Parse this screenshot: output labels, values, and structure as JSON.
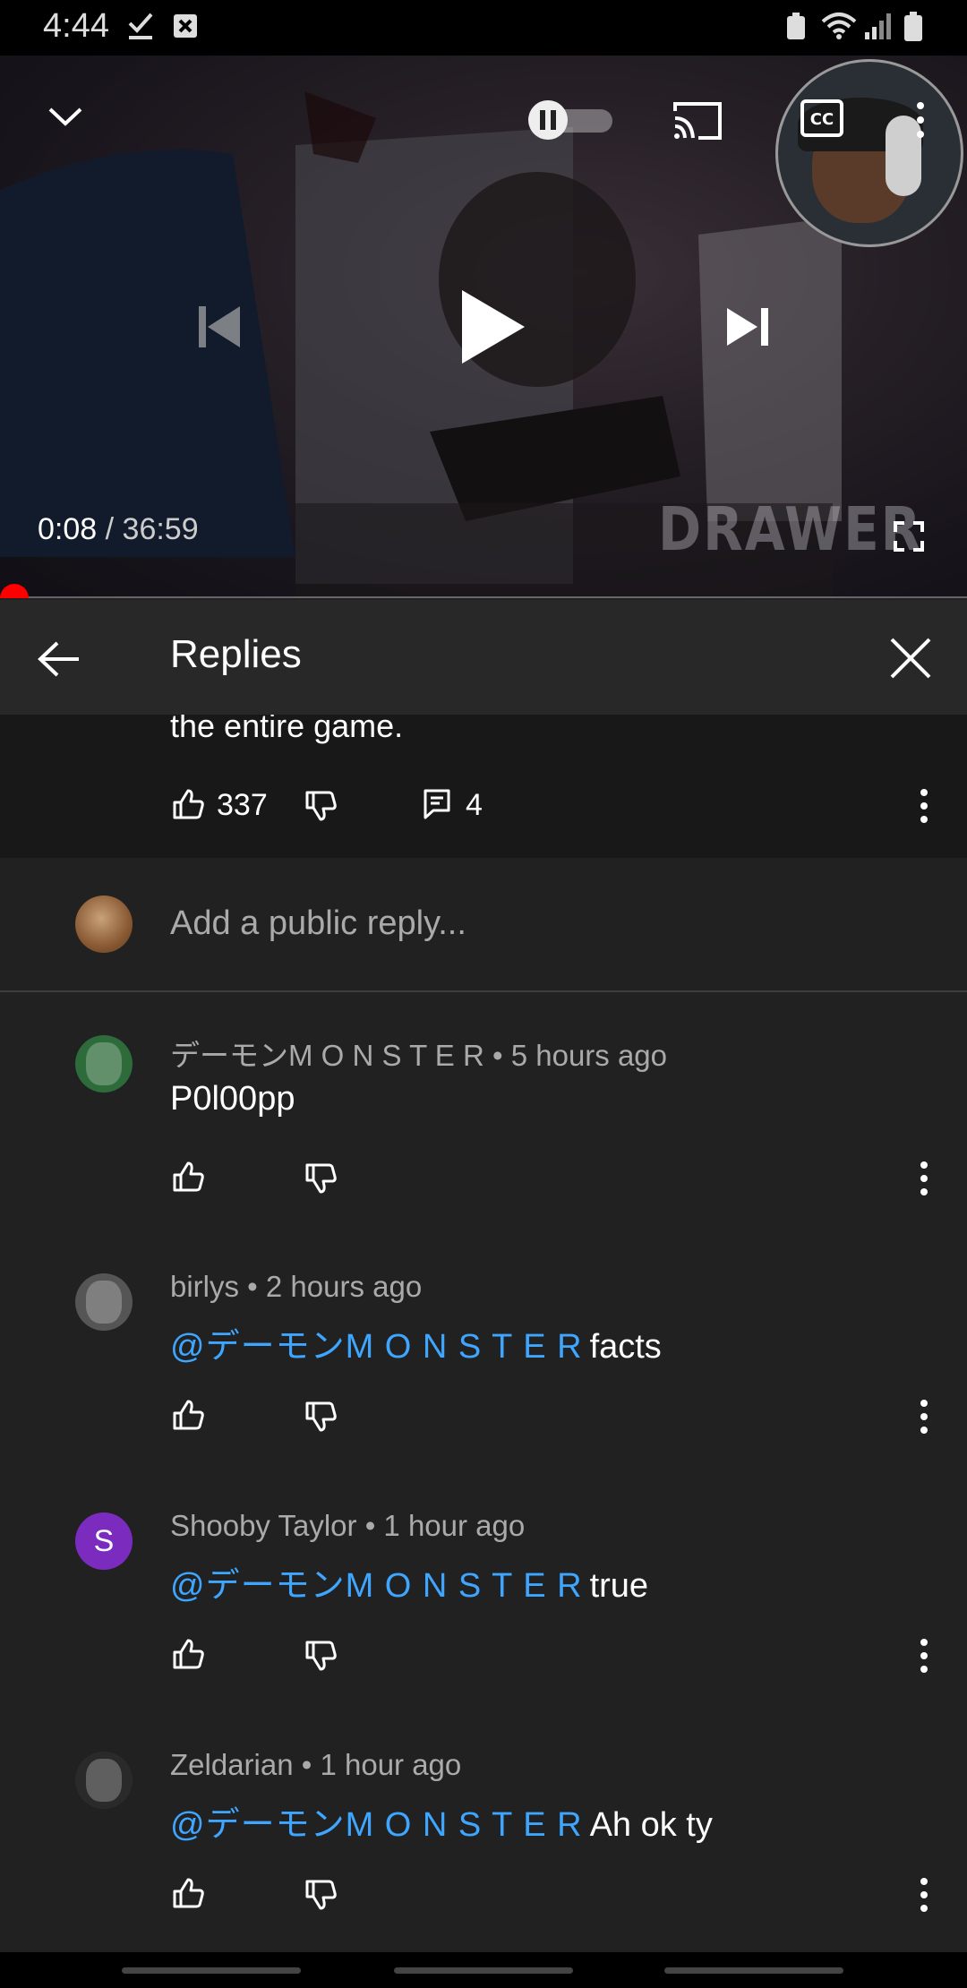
{
  "status_bar": {
    "time": "4:44"
  },
  "player": {
    "current_time": "0:08",
    "separator": "/",
    "duration": "36:59",
    "watermark": "DRAWER",
    "progress_fraction": 0.004
  },
  "replies_panel": {
    "title": "Replies",
    "parent_comment": {
      "text_fragment": "the entire game.",
      "likes": "337",
      "reply_count": "4"
    },
    "add_reply_placeholder": "Add a public reply...",
    "replies": [
      {
        "author": "デーモンM O N S T E R",
        "time": "5 hours ago",
        "mention": "",
        "text": "P0l00pp",
        "avatar_color": "#2e6b3a"
      },
      {
        "author": "birlys",
        "time": "2 hours ago",
        "mention": "@デーモンM O N S T E R",
        "text": "facts",
        "avatar_color": "#555555"
      },
      {
        "author": "Shooby Taylor",
        "time": "1 hour ago",
        "mention": "@デーモンM O N S T E R",
        "text": "true",
        "avatar_color": "#7b2cbf",
        "avatar_letter": "S"
      },
      {
        "author": "Zeldarian",
        "time": "1 hour ago",
        "mention": "@デーモンM O N S T E R",
        "text": "Ah ok ty",
        "avatar_color": "#2a2a2a"
      }
    ]
  },
  "colors": {
    "accent_link": "#3ea6ff",
    "progress": "#ff0000",
    "background": "#212121"
  }
}
